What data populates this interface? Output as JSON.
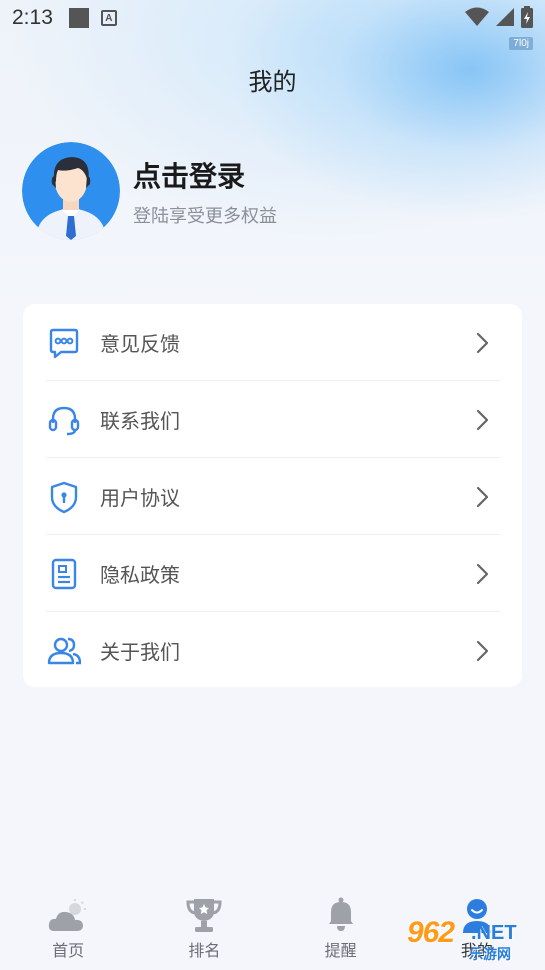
{
  "status_bar": {
    "time": "2:13",
    "notification_letter": "A",
    "badge": "7l0j"
  },
  "header": {
    "title": "我的"
  },
  "profile": {
    "login_title": "点击登录",
    "login_subtitle": "登陆享受更多权益",
    "avatar_icon": "user-avatar-icon"
  },
  "menu": {
    "items": [
      {
        "label": "意见反馈",
        "icon": "feedback-icon"
      },
      {
        "label": "联系我们",
        "icon": "headset-icon"
      },
      {
        "label": "用户协议",
        "icon": "shield-icon"
      },
      {
        "label": "隐私政策",
        "icon": "document-icon"
      },
      {
        "label": "关于我们",
        "icon": "users-icon"
      }
    ]
  },
  "tabbar": {
    "items": [
      {
        "label": "首页",
        "icon": "weather-icon",
        "active": false
      },
      {
        "label": "排名",
        "icon": "trophy-icon",
        "active": false
      },
      {
        "label": "提醒",
        "icon": "bell-icon",
        "active": false
      },
      {
        "label": "我的",
        "icon": "profile-icon",
        "active": true
      }
    ]
  },
  "watermark": {
    "number": "962",
    "suffix": ".NET",
    "text": "乐游网"
  },
  "colors": {
    "accent": "#2b7de0",
    "icon_blue": "#3a86e8",
    "text_primary": "#1a1a1a",
    "text_secondary": "#8a8f99",
    "background": "#f4f6fb"
  }
}
